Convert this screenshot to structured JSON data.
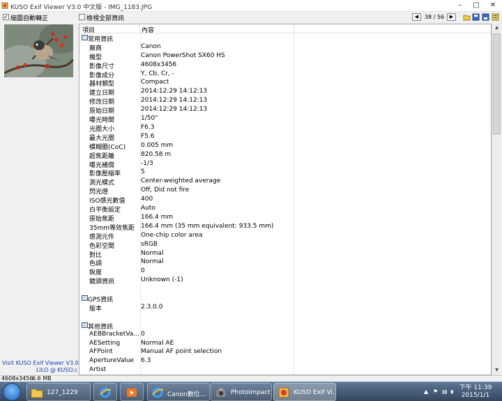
{
  "window": {
    "title": "KUSO Exif Viewer V3.0 中文版 - IMG_1183.JPG",
    "minimize_icon": "minimize-icon",
    "maximize_icon": "maximize-icon",
    "close_icon": "close-icon"
  },
  "toolbar": {
    "shrink_label": "縮圖自動轉正",
    "shrink_checked": true,
    "show_all_label": "檢視全部資訊",
    "show_all_checked": false,
    "counter": "38 / 56",
    "prev_icon": "chevron-left-icon",
    "next_icon": "chevron-right-icon"
  },
  "left": {
    "visit_text": "Visit KUSO Exif Viewer V3.0",
    "lilo_text": "LILO @ KUSO.c"
  },
  "table": {
    "col_item": "項目",
    "col_content": "內容",
    "sections": [
      {
        "title": "常用資訊",
        "rows": [
          [
            "廠商",
            "Canon"
          ],
          [
            "機型",
            "Canon PowerShot SX60 HS"
          ],
          [
            "影像尺寸",
            "4608x3456"
          ],
          [
            "影像成分",
            "Y, Cb, Cr, -"
          ],
          [
            "器材類型",
            "Compact"
          ],
          [
            "建立日期",
            "2014:12:29 14:12:13"
          ],
          [
            "修改日期",
            "2014:12:29 14:12:13"
          ],
          [
            "原始日期",
            "2014:12:29 14:12:13"
          ],
          [
            "曝光時間",
            "1/50\""
          ],
          [
            "光圈大小",
            "F6.3"
          ],
          [
            "最大光圈",
            "F5.6"
          ],
          [
            "模糊圈(CoC)",
            "0.005 mm"
          ],
          [
            "超焦距離",
            "820.58 m"
          ],
          [
            "曝光補償",
            "-1/3"
          ],
          [
            "影像壓縮率",
            "5"
          ],
          [
            "測光模式",
            "Center-weighted average"
          ],
          [
            "閃光燈",
            "Off, Did not fire"
          ],
          [
            "ISO感光數值",
            "400"
          ],
          [
            "白平衡設定",
            "Auto"
          ],
          [
            "原始焦距",
            "166.4 mm"
          ],
          [
            "35mm等效焦距",
            "166.4 mm (35 mm equivalent: 933.5 mm)"
          ],
          [
            "感測元件",
            "One-chip color area"
          ],
          [
            "色彩空間",
            "sRGB"
          ],
          [
            "對比",
            "Normal"
          ],
          [
            "色調",
            "Normal"
          ],
          [
            "銳度",
            "0"
          ],
          [
            "鏡頭資訊",
            "Unknown (-1)"
          ]
        ]
      },
      {
        "title": "GPS資訊",
        "rows": [
          [
            "版本",
            "2.3.0.0"
          ]
        ]
      },
      {
        "title": "其他資訊",
        "rows": [
          [
            "AEBBracketVa...",
            "0"
          ],
          [
            "AESetting",
            "Normal AE"
          ],
          [
            "AFPoint",
            "Manual AF point selection"
          ],
          [
            "ApertureValue",
            "6.3"
          ],
          [
            "Artist",
            ""
          ]
        ]
      }
    ]
  },
  "status": {
    "dimensions": "4608x3456",
    "size": "6.6 MB"
  },
  "taskbar": {
    "tasks": [
      {
        "label": "127_1229",
        "icon": "folder-icon"
      },
      {
        "label": "",
        "icon": "ie-icon"
      },
      {
        "label": "",
        "icon": "media-player-icon"
      },
      {
        "label": "Canon數位...",
        "icon": "ie-icon"
      },
      {
        "label": "PhotoImpact",
        "icon": "photoimpact-icon"
      },
      {
        "label": "KUSO Exif Vi...",
        "icon": "kuso-icon"
      }
    ],
    "clock_time": "下午 11:39",
    "clock_date": "2015/1/1"
  },
  "colors": {
    "taskbar": "#3b5270",
    "link": "#1a3fb3"
  }
}
